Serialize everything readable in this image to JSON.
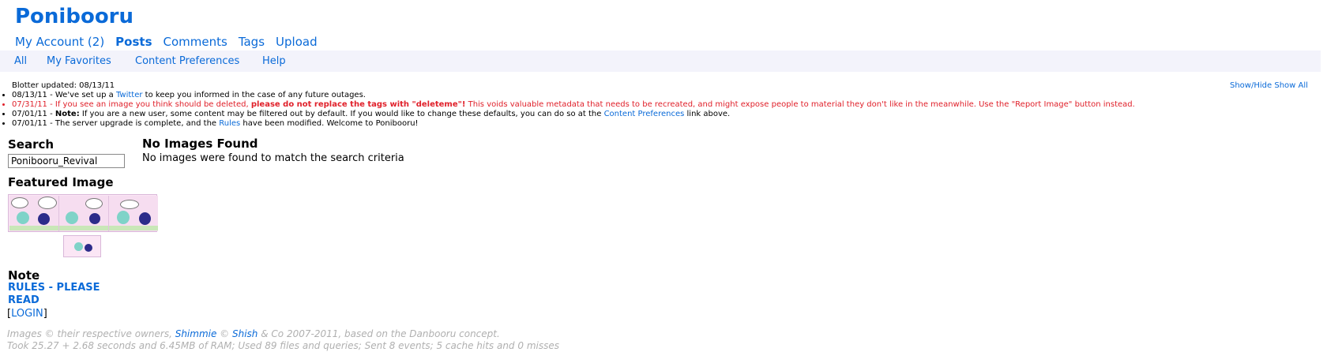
{
  "site": {
    "title": "Ponibooru"
  },
  "main_nav": {
    "account": "My Account (2)",
    "posts": "Posts",
    "comments": "Comments",
    "tags": "Tags",
    "upload": "Upload"
  },
  "sub_nav": {
    "all": "All",
    "favorites": "My Favorites",
    "content_prefs": "Content Preferences",
    "help": "Help"
  },
  "blotter": {
    "updated": "Blotter updated: 08/13/11",
    "show_hide": "Show/Hide",
    "show_all": "Show All",
    "entries": [
      {
        "pre": "08/13/11 - We've set up a ",
        "link": "Twitter",
        "post": " to keep you informed in the case of any future outages."
      },
      {
        "pre": "07/31/11 - If you see an image you think should be deleted, ",
        "bold": "please do not replace the tags with \"deleteme\"!",
        "post": " This voids valuable metadata that needs to be recreated, and might expose people to material they don't like in the meanwhile. Use the \"Report Image\" button instead."
      },
      {
        "pre": "07/01/11 - ",
        "bold": "Note:",
        "mid": " If you are a new user, some content may be filtered out by default. If you would like to change these defaults, you can do so at the ",
        "link": "Content Preferences",
        "post": " link above."
      },
      {
        "pre": "07/01/11 - The server upgrade is complete, and the ",
        "link": "Rules",
        "post": " have been modified. Welcome to Ponibooru!"
      }
    ]
  },
  "sidebar": {
    "search_title": "Search",
    "search_value": "Ponibooru_Revival",
    "featured_title": "Featured Image",
    "note_title": "Note",
    "note_link_line1": "RULES - PLEASE",
    "note_link_line2": "READ",
    "login_open": "[",
    "login_label": "LOGIN",
    "login_close": "]"
  },
  "content": {
    "heading": "No Images Found",
    "message": "No images were found to match the search criteria"
  },
  "footer": {
    "line1_pre": "Images © their respective owners, ",
    "shimmie": "Shimmie",
    "copy": " © ",
    "shish": "Shish",
    "line1_post": " & Co 2007-2011, based on the Danbooru concept.",
    "line2": "Took 25.27 + 2.68 seconds and 6.45MB of RAM; Used 89 files and queries; Sent 8 events; 5 cache hits and 0 misses"
  },
  "colors": {
    "link": "#0a6ad8",
    "important": "#e0202a",
    "subnav_bg": "#f3f3fb"
  }
}
